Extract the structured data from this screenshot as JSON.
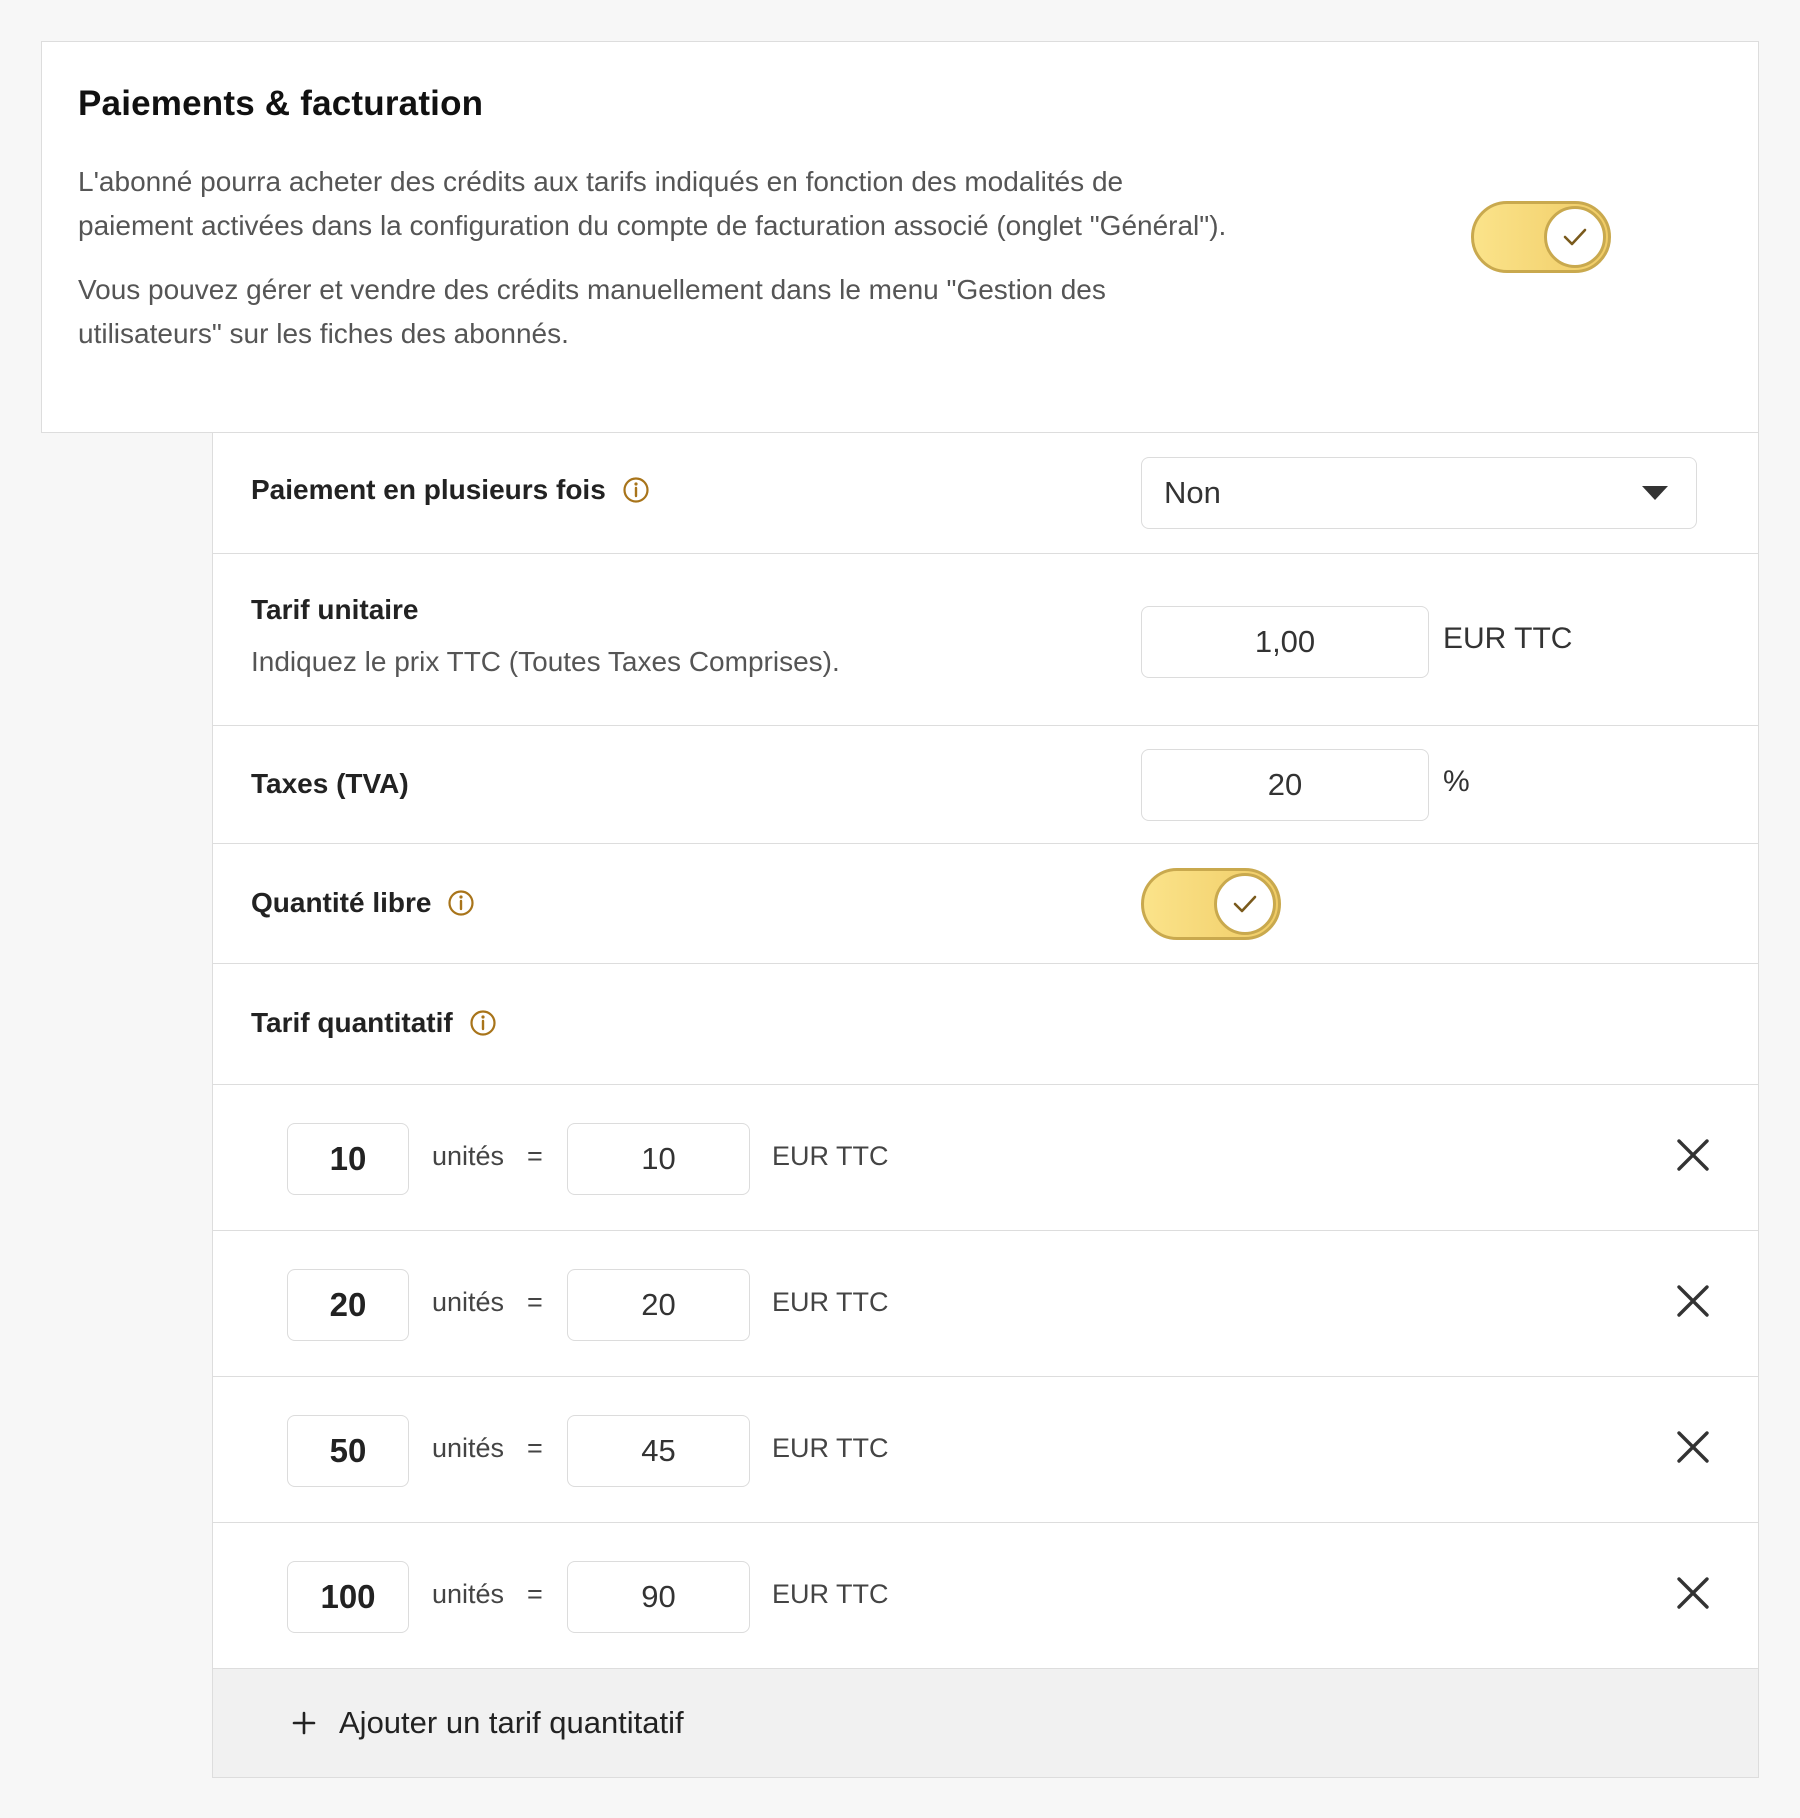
{
  "header": {
    "title": "Paiements & facturation",
    "desc1": "L'abonné pourra acheter des crédits aux tarifs indiqués en fonction des modalités de paiement activées dans la configuration du compte de facturation associé (onglet \"Général\").",
    "desc2": "Vous pouvez gérer et vendre des crédits manuellement dans le menu \"Gestion des utilisateurs\" sur les fiches des abonnés.",
    "toggle_on": true
  },
  "installments": {
    "label": "Paiement en plusieurs fois",
    "selected": "Non"
  },
  "unit_price": {
    "label": "Tarif unitaire",
    "hint": "Indiquez le prix TTC (Toutes Taxes Comprises).",
    "value": "1,00",
    "unit": "EUR TTC"
  },
  "tax": {
    "label": "Taxes (TVA)",
    "value": "20",
    "unit": "%"
  },
  "free_quantity": {
    "label": "Quantité libre",
    "toggle_on": true
  },
  "quantity_pricing": {
    "label": "Tarif quantitatif",
    "units_word": "unités",
    "equals": "=",
    "currency": "EUR TTC",
    "tiers": [
      {
        "qty": "10",
        "price": "10"
      },
      {
        "qty": "20",
        "price": "20"
      },
      {
        "qty": "50",
        "price": "45"
      },
      {
        "qty": "100",
        "price": "90"
      }
    ],
    "add_label": "Ajouter un tarif quantitatif"
  },
  "colors": {
    "accent": "#c9a94e",
    "toggle_fill": "#f5d471",
    "info_icon": "#a8741a"
  },
  "icons": {
    "info": "info-circle-icon",
    "check": "check-icon",
    "close": "close-icon",
    "plus": "plus-icon",
    "caret": "caret-down-icon"
  }
}
